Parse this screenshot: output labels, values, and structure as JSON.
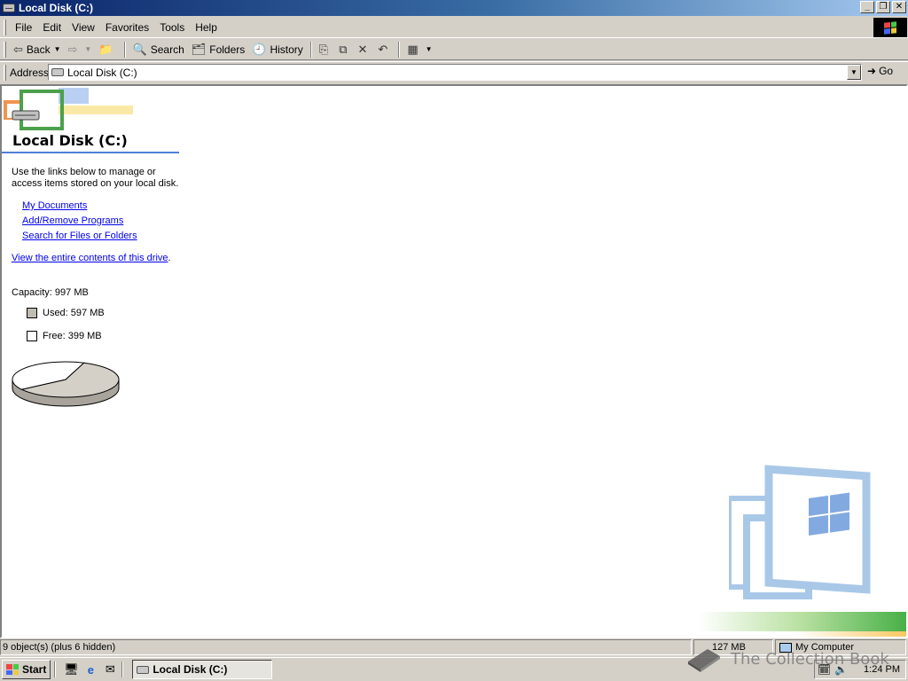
{
  "window": {
    "title": "Local Disk (C:)",
    "minimize_symbol": "_",
    "restore_symbol": "❐",
    "close_symbol": "✕"
  },
  "menu": {
    "items": [
      {
        "label": "File"
      },
      {
        "label": "Edit"
      },
      {
        "label": "View"
      },
      {
        "label": "Favorites"
      },
      {
        "label": "Tools"
      },
      {
        "label": "Help"
      }
    ]
  },
  "toolbar": {
    "back_label": "Back",
    "search_label": "Search",
    "folders_label": "Folders",
    "history_label": "History"
  },
  "address": {
    "label": "Address",
    "value": "Local Disk (C:)",
    "go_label": "Go"
  },
  "content": {
    "heading": "Local Disk (C:)",
    "description": "Use the links below to manage or access items stored on your local disk.",
    "links": [
      {
        "label": "My Documents"
      },
      {
        "label": "Add/Remove Programs"
      },
      {
        "label": "Search for Files or Folders"
      }
    ],
    "view_all_label": "View the entire contents of this drive",
    "view_all_suffix": ".",
    "capacity_label": "Capacity: 997 MB",
    "used_label": "Used: 597 MB",
    "free_label": "Free: 399 MB",
    "colors": {
      "used": "#c0bcb4",
      "free": "#ffffff",
      "link": "#0000ee",
      "rule": "#4e7fd6"
    }
  },
  "disk_usage": {
    "used_mb": 597,
    "free_mb": 399,
    "capacity_mb": 997
  },
  "statusbar": {
    "objects": "9 object(s) (plus 6 hidden)",
    "size": "127 MB",
    "zone": "My Computer"
  },
  "taskbar": {
    "start_label": "Start",
    "task_label": "Local Disk (C:)",
    "clock": "1:24 PM"
  },
  "watermark": {
    "text": "The Collection Book"
  }
}
